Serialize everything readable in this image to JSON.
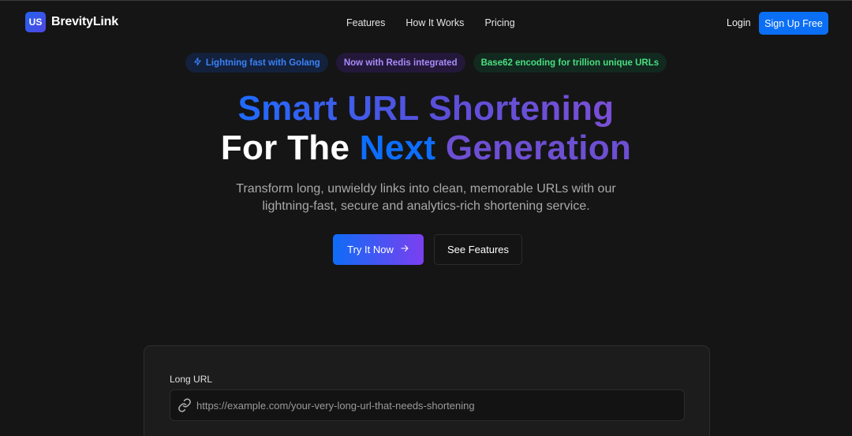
{
  "nav": {
    "logo_badge": "US",
    "logo_text": "BrevityLink",
    "links": [
      "Features",
      "How It Works",
      "Pricing"
    ],
    "login": "Login",
    "signup": "Sign Up Free"
  },
  "badges": {
    "golang": "Lightning fast with Golang",
    "redis": "Now with Redis integrated",
    "base62": "Base62 encoding for trillion unique URLs"
  },
  "hero": {
    "line1": "Smart URL Shortening",
    "line2_a": "For The",
    "line2_b": "Next",
    "line2_c": "Generation",
    "subtitle_1": "Transform long, unwieldy links into clean, memorable URLs with our",
    "subtitle_2": "lightning-fast, secure and analytics-rich shortening service.",
    "try_button": "Try It Now",
    "features_button": "See Features"
  },
  "form": {
    "long_url_label": "Long URL",
    "long_url_placeholder": "https://example.com/your-very-long-url-that-needs-shortening"
  },
  "icons": {
    "bolt": "lightning-bolt-icon",
    "arrow": "arrow-right-icon",
    "link": "link-icon"
  },
  "colors": {
    "accent_blue": "#0b6ff5",
    "accent_purple": "#7b3ff0",
    "badge_green": "#4ade80",
    "background": "#151515"
  }
}
